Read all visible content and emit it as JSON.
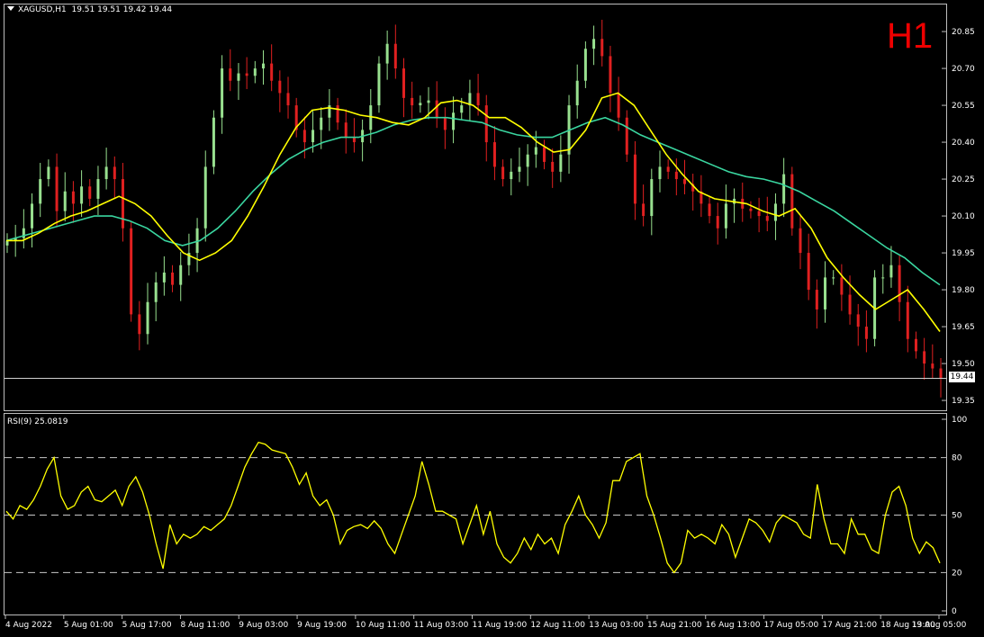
{
  "header": {
    "symbol": "XAGUSD,H1",
    "ohlc": "19.51 19.51 19.42 19.44",
    "timeframe": "H1",
    "current_price": "19.44"
  },
  "rsi_header": {
    "label": "RSI(9) 25.0819"
  },
  "colors": {
    "background": "#000000",
    "bull_candle": "#98e08f",
    "bear_candle": "#e02020",
    "ma_fast": "#ffff00",
    "ma_slow": "#3ad6a0",
    "rsi_line": "#ffff00",
    "grid": "#c8c8c8",
    "timeframe_text": "#ee0000"
  },
  "chart_data": [
    {
      "type": "candlestick",
      "title": "XAGUSD,H1",
      "ylim": [
        19.31,
        20.96
      ],
      "y_ticks": [
        "20.85",
        "20.70",
        "20.55",
        "20.40",
        "20.25",
        "20.10",
        "19.95",
        "19.80",
        "19.65",
        "19.50",
        "19.35"
      ],
      "x_ticks": [
        "4 Aug 2022",
        "5 Aug 01:00",
        "5 Aug 17:00",
        "8 Aug 11:00",
        "9 Aug 03:00",
        "9 Aug 19:00",
        "10 Aug 11:00",
        "11 Aug 03:00",
        "11 Aug 19:00",
        "12 Aug 11:00",
        "13 Aug 03:00",
        "15 Aug 21:00",
        "16 Aug 13:00",
        "17 Aug 05:00",
        "17 Aug 21:00",
        "18 Aug 13:00",
        "19 Aug 05:00"
      ],
      "close_path": [
        20.0,
        20.01,
        20.05,
        20.15,
        20.25,
        20.3,
        20.12,
        20.2,
        20.15,
        20.22,
        20.17,
        20.25,
        20.3,
        20.25,
        20.05,
        19.7,
        19.62,
        19.75,
        19.83,
        19.87,
        19.82,
        19.9,
        19.95,
        20.05,
        20.3,
        20.5,
        20.7,
        20.65,
        20.68,
        20.67,
        20.7,
        20.72,
        20.65,
        20.6,
        20.55,
        20.45,
        20.4,
        20.45,
        20.5,
        20.55,
        20.48,
        20.42,
        20.4,
        20.45,
        20.55,
        20.72,
        20.8,
        20.7,
        20.58,
        20.55,
        20.56,
        20.57,
        20.5,
        20.45,
        20.52,
        20.55,
        20.6,
        20.55,
        20.4,
        20.3,
        20.25,
        20.28,
        20.3,
        20.35,
        20.38,
        20.32,
        20.28,
        20.35,
        20.55,
        20.65,
        20.78,
        20.82,
        20.75,
        20.6,
        20.5,
        20.35,
        20.15,
        20.1,
        20.25,
        20.3,
        20.28,
        20.25,
        20.23,
        20.2,
        20.15,
        20.1,
        20.05,
        20.15,
        20.17,
        20.13,
        20.12,
        20.1,
        20.08,
        20.15,
        20.27,
        20.05,
        19.95,
        19.8,
        19.72,
        19.85,
        19.85,
        19.78,
        19.7,
        19.65,
        19.6,
        19.85,
        19.85,
        19.9,
        19.75,
        19.6,
        19.55,
        19.5,
        19.48,
        19.44
      ],
      "series": [
        {
          "name": "MA fast",
          "values": [
            20.0,
            20.0,
            20.03,
            20.07,
            20.1,
            20.12,
            20.15,
            20.18,
            20.15,
            20.1,
            20.02,
            19.95,
            19.92,
            19.95,
            20.0,
            20.1,
            20.22,
            20.35,
            20.46,
            20.53,
            20.54,
            20.53,
            20.51,
            20.5,
            20.48,
            20.47,
            20.5,
            20.56,
            20.57,
            20.55,
            20.5,
            20.5,
            20.46,
            20.4,
            20.36,
            20.37,
            20.45,
            20.58,
            20.6,
            20.55,
            20.45,
            20.35,
            20.27,
            20.2,
            20.17,
            20.16,
            20.15,
            20.12,
            20.1,
            20.13,
            20.05,
            19.93,
            19.85,
            19.78,
            19.72,
            19.76,
            19.8,
            19.72,
            19.63
          ]
        },
        {
          "name": "MA slow",
          "values": [
            20.0,
            20.02,
            20.04,
            20.06,
            20.08,
            20.1,
            20.1,
            20.08,
            20.05,
            20.0,
            19.98,
            20.0,
            20.05,
            20.12,
            20.2,
            20.27,
            20.33,
            20.37,
            20.4,
            20.42,
            20.42,
            20.44,
            20.47,
            20.49,
            20.5,
            20.5,
            20.49,
            20.48,
            20.45,
            20.43,
            20.42,
            20.42,
            20.45,
            20.48,
            20.5,
            20.47,
            20.43,
            20.4,
            20.37,
            20.34,
            20.31,
            20.28,
            20.26,
            20.25,
            20.23,
            20.2,
            20.16,
            20.12,
            20.07,
            20.02,
            19.97,
            19.93,
            19.87,
            19.82
          ]
        }
      ]
    },
    {
      "type": "line",
      "title": "RSI(9) 25.0819",
      "ylim": [
        0,
        100
      ],
      "y_ticks": [
        "100",
        "80",
        "50",
        "20",
        "0"
      ],
      "levels": [
        80,
        50,
        20
      ],
      "series": [
        {
          "name": "RSI(9)",
          "values": [
            52,
            48,
            55,
            53,
            58,
            65,
            74,
            80,
            60,
            53,
            55,
            62,
            65,
            58,
            57,
            60,
            63,
            55,
            65,
            70,
            62,
            50,
            35,
            22,
            45,
            35,
            40,
            38,
            40,
            44,
            42,
            45,
            48,
            55,
            65,
            75,
            82,
            88,
            87,
            84,
            83,
            82,
            75,
            66,
            72,
            60,
            55,
            58,
            50,
            35,
            42,
            44,
            45,
            43,
            47,
            43,
            35,
            30,
            40,
            50,
            60,
            78,
            66,
            52,
            52,
            50,
            48,
            35,
            45,
            55,
            40,
            52,
            35,
            28,
            25,
            30,
            38,
            32,
            40,
            35,
            38,
            30,
            45,
            52,
            60,
            50,
            45,
            38,
            46,
            68,
            68,
            78,
            80,
            82,
            60,
            50,
            38,
            25,
            20,
            25,
            42,
            38,
            40,
            38,
            35,
            45,
            40,
            28,
            38,
            48,
            46,
            42,
            36,
            46,
            50,
            48,
            46,
            40,
            38,
            66,
            48,
            35,
            35,
            30,
            48,
            40,
            40,
            32,
            30,
            50,
            62,
            65,
            55,
            38,
            30,
            36,
            33,
            25
          ]
        }
      ]
    }
  ]
}
